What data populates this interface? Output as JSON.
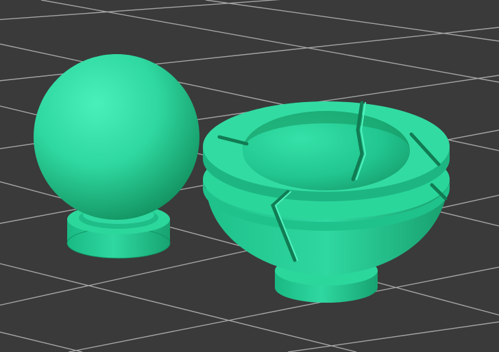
{
  "viewport": {
    "background_color": "#3a3a3a",
    "grid_line_color": "#a5a5a5",
    "model_color": "#2fd8a0",
    "model_shadow_color": "#12915f",
    "model_highlight_color": "#4af0ba"
  },
  "objects": [
    {
      "label": "sphere-on-pedestal"
    },
    {
      "label": "split-socket-cup"
    }
  ]
}
